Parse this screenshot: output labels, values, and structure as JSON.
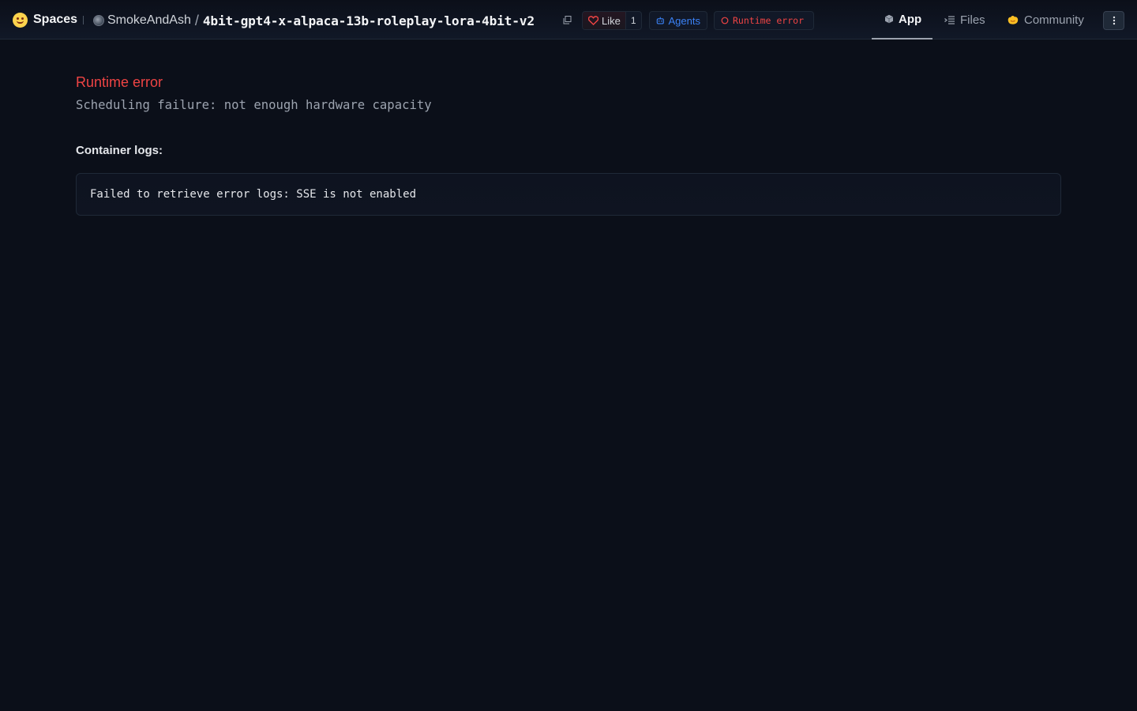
{
  "header": {
    "brand_label": "Spaces",
    "owner": "SmokeAndAsh",
    "separator": "/",
    "repo_name": "4bit-gpt4-x-alpaca-13b-roleplay-lora-4bit-v2",
    "like_label": "Like",
    "like_count": "1",
    "agents_label": "Agents",
    "status_label": "Runtime error",
    "tabs": [
      {
        "label": "App",
        "icon": "cube-icon",
        "active": true
      },
      {
        "label": "Files",
        "icon": "files-icon",
        "active": false
      },
      {
        "label": "Community",
        "icon": "community-icon",
        "active": false
      }
    ]
  },
  "main": {
    "error_title": "Runtime error",
    "error_description": "Scheduling failure: not enough hardware capacity",
    "logs_label": "Container logs:",
    "logs_text": "Failed to retrieve error logs: SSE is not enabled"
  },
  "colors": {
    "background": "#0b0f19",
    "error": "#ef4444",
    "accent_blue": "#3b82f6",
    "muted_text": "#9ca3af"
  }
}
